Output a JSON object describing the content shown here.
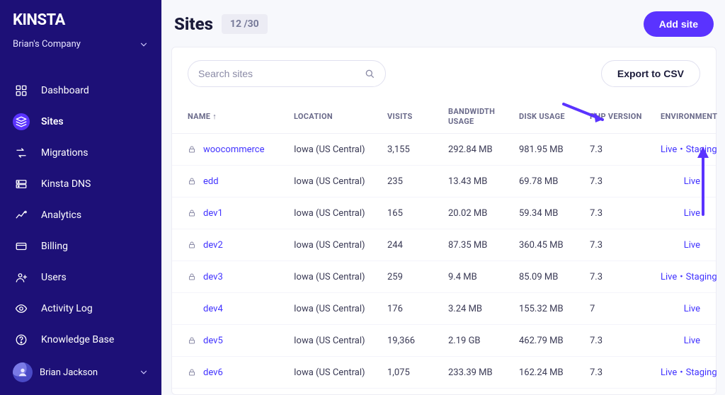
{
  "brand": "KINSTA",
  "company_name": "Brian's Company",
  "user_name": "Brian Jackson",
  "page": {
    "title": "Sites",
    "count": "12 /30",
    "add_site_label": "Add site"
  },
  "sidebar": {
    "items": [
      {
        "label": "Dashboard",
        "icon": "grid"
      },
      {
        "label": "Sites",
        "icon": "stack",
        "active": true
      },
      {
        "label": "Migrations",
        "icon": "swap"
      },
      {
        "label": "Kinsta DNS",
        "icon": "dns"
      },
      {
        "label": "Analytics",
        "icon": "chart"
      },
      {
        "label": "Billing",
        "icon": "card"
      },
      {
        "label": "Users",
        "icon": "user-plus"
      },
      {
        "label": "Activity Log",
        "icon": "eye"
      },
      {
        "label": "Knowledge Base",
        "icon": "help"
      }
    ]
  },
  "toolbar": {
    "search_placeholder": "Search sites",
    "export_label": "Export to CSV"
  },
  "columns": {
    "name": "NAME ↑",
    "location": "LOCATION",
    "visits": "VISITS",
    "bandwidth": "BANDWIDTH USAGE",
    "disk": "DISK USAGE",
    "php": "PHP VERSION",
    "env": "ENVIRONMENT"
  },
  "env_labels": {
    "live": "Live",
    "staging": "Staging"
  },
  "rows": [
    {
      "lock": true,
      "name": "woocommerce",
      "location": "Iowa (US Central)",
      "visits": "3,155",
      "bandwidth": "292.84 MB",
      "disk": "981.95 MB",
      "php": "7.3",
      "live": true,
      "staging": true
    },
    {
      "lock": true,
      "name": "edd",
      "location": "Iowa (US Central)",
      "visits": "235",
      "bandwidth": "13.43 MB",
      "disk": "69.78 MB",
      "php": "7.3",
      "live": true,
      "staging": false
    },
    {
      "lock": true,
      "name": "dev1",
      "location": "Iowa (US Central)",
      "visits": "165",
      "bandwidth": "20.02 MB",
      "disk": "59.34 MB",
      "php": "7.3",
      "live": true,
      "staging": false
    },
    {
      "lock": true,
      "name": "dev2",
      "location": "Iowa (US Central)",
      "visits": "244",
      "bandwidth": "87.35 MB",
      "disk": "360.45 MB",
      "php": "7.3",
      "live": true,
      "staging": false
    },
    {
      "lock": true,
      "name": "dev3",
      "location": "Iowa (US Central)",
      "visits": "259",
      "bandwidth": "9.4 MB",
      "disk": "85.09 MB",
      "php": "7.3",
      "live": true,
      "staging": true
    },
    {
      "lock": false,
      "name": "dev4",
      "location": "Iowa (US Central)",
      "visits": "176",
      "bandwidth": "3.24 MB",
      "disk": "155.32 MB",
      "php": "7",
      "live": true,
      "staging": false
    },
    {
      "lock": true,
      "name": "dev5",
      "location": "Iowa (US Central)",
      "visits": "19,366",
      "bandwidth": "2.19 GB",
      "disk": "462.79 MB",
      "php": "7.3",
      "live": true,
      "staging": false
    },
    {
      "lock": true,
      "name": "dev6",
      "location": "Iowa (US Central)",
      "visits": "1,075",
      "bandwidth": "233.39 MB",
      "disk": "162.24 MB",
      "php": "7.3",
      "live": true,
      "staging": true
    }
  ]
}
